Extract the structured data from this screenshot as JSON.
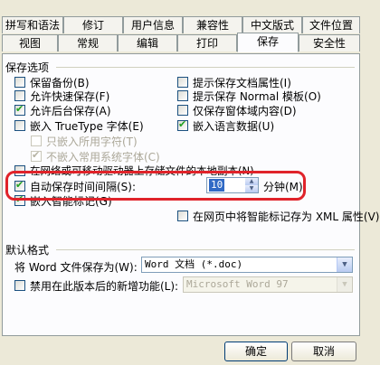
{
  "tabs_row1": [
    "拼写和语法",
    "修订",
    "用户信息",
    "兼容性",
    "中文版式",
    "文件位置"
  ],
  "tabs_row2": [
    "视图",
    "常规",
    "编辑",
    "打印",
    "保存",
    "安全性"
  ],
  "save_options": {
    "title": "保存选项",
    "left": [
      {
        "label": "保留备份(B)",
        "checked": false
      },
      {
        "label": "允许快速保存(F)",
        "checked": false
      },
      {
        "label": "允许后台保存(A)",
        "checked": true
      },
      {
        "label": "嵌入 TrueType 字体(E)",
        "checked": false
      }
    ],
    "right": [
      {
        "label": "提示保存文档属性(I)",
        "checked": false
      },
      {
        "label": "提示保存 Normal 模板(O)",
        "checked": false
      },
      {
        "label": "仅保存窗体域内容(D)",
        "checked": false
      },
      {
        "label": "嵌入语言数据(U)",
        "checked": true
      }
    ],
    "sub": [
      {
        "label": "只嵌入所用字符(T)",
        "checked": false
      },
      {
        "label": "不嵌入常用系统字体(C)",
        "checked": true
      }
    ],
    "network_copy": "在网络或可移动驱动器上存储文件的本地副本(N)",
    "autosave_label": "自动保存时间间隔(S):",
    "autosave_value": "10",
    "autosave_unit": "分钟(M)",
    "smart_tags": "嵌入智能标记(G)",
    "smart_tags_xml": "在网页中将智能标记存为 XML 属性(V)"
  },
  "default_format": {
    "title": "默认格式",
    "save_as_label": "将 Word 文件保存为(W):",
    "save_as_value": "Word 文档 (*.doc)",
    "disable_features_label": "禁用在此版本后的新增功能(L):",
    "disable_features_value": "Microsoft Word 97"
  },
  "buttons": {
    "ok": "确定",
    "cancel": "取消"
  },
  "colors": {
    "accent": "#e0232a",
    "background": "#ece9d8"
  }
}
